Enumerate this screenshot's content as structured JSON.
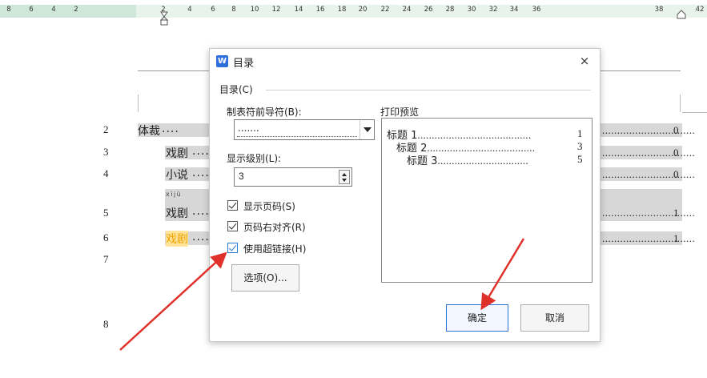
{
  "ruler": {
    "ticks": [
      "8",
      "6",
      "4",
      "2",
      "2",
      "4",
      "6",
      "8",
      "10",
      "12",
      "14",
      "16",
      "18",
      "20",
      "22",
      "24",
      "26",
      "28",
      "30",
      "32",
      "34",
      "36",
      "38",
      "42"
    ]
  },
  "document": {
    "line_numbers": [
      "2",
      "3",
      "4",
      "5",
      "6",
      "7",
      "8"
    ],
    "toc": [
      {
        "text": "体裁",
        "page": "0"
      },
      {
        "text": "戏剧",
        "page": "0"
      },
      {
        "text": "小说",
        "page": "0"
      },
      {
        "text": "戏剧",
        "pinyin": "xìjù",
        "page": "1"
      },
      {
        "text": "戏剧",
        "page": "1"
      }
    ],
    "dots": "....",
    "right_dots": "..............................."
  },
  "dialog": {
    "title": "目录",
    "app_icon_letter": "W",
    "close_label": "×",
    "group_label": "目录(C)",
    "tab_leader_label": "制表符前导符(B):",
    "tab_leader_value": ".......",
    "level_label": "显示级别(L):",
    "level_value": "3",
    "checkboxes": [
      {
        "label": "显示页码(S)",
        "checked": true
      },
      {
        "label": "页码右对齐(R)",
        "checked": true
      },
      {
        "label": "使用超链接(H)",
        "checked": true
      }
    ],
    "options_button": "选项(O)...",
    "preview_label": "打印预览",
    "preview_lines": [
      {
        "text": "标题 1",
        "dots": "........................................",
        "page": "1"
      },
      {
        "text": "标题 2",
        "dots": "......................................",
        "page": "3"
      },
      {
        "text": "标题 3",
        "dots": "................................",
        "page": "5"
      }
    ],
    "ok_button": "确定",
    "cancel_button": "取消"
  },
  "colors": {
    "accent": "#2f6fdc",
    "arrow": "#e0302a",
    "ruler_band": "#e8f3ec"
  }
}
